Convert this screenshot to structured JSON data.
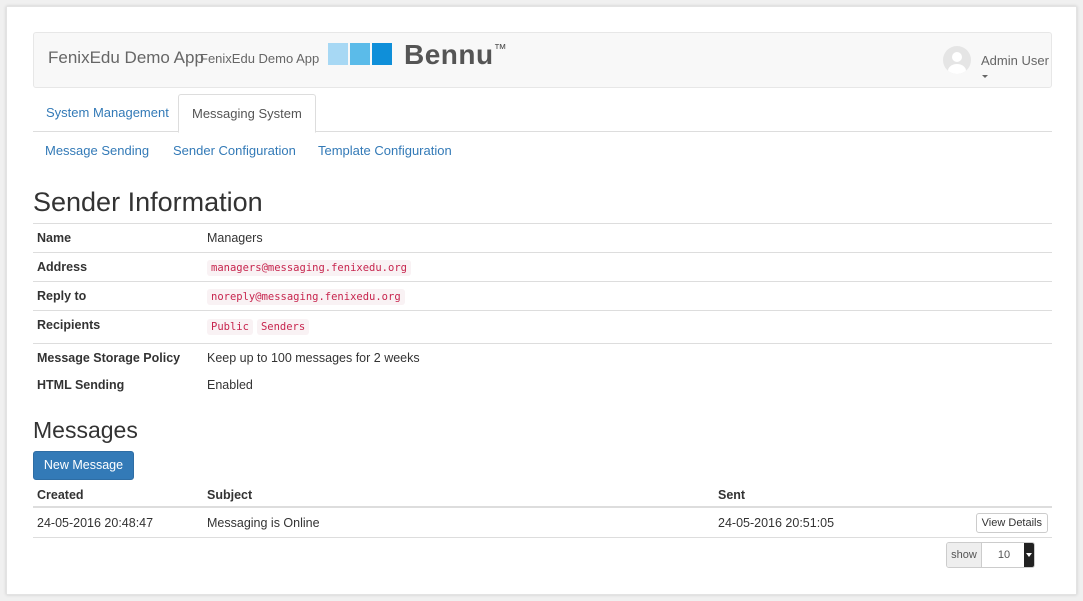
{
  "header": {
    "brand_main": "FenixEdu Demo App",
    "brand_sub": "FenixEdu Demo App",
    "logo_text": "Bennu",
    "logo_mark": "™",
    "logo_colors": [
      "#a7d8f4",
      "#5bbbe9",
      "#0f8fd9"
    ],
    "user_name": "Admin User"
  },
  "tabs": [
    {
      "label": "System Management",
      "active": false
    },
    {
      "label": "Messaging System",
      "active": true
    }
  ],
  "subnav": [
    {
      "label": "Message Sending"
    },
    {
      "label": "Sender Configuration"
    },
    {
      "label": "Template Configuration"
    }
  ],
  "sender": {
    "title": "Sender Information",
    "name_label": "Name",
    "name_value": "Managers",
    "address_label": "Address",
    "address_value": "managers@messaging.fenixedu.org",
    "reply_label": "Reply to",
    "reply_value": "noreply@messaging.fenixedu.org",
    "recipients_label": "Recipients",
    "recipients": [
      "Public",
      "Senders"
    ],
    "storage_label": "Message Storage Policy",
    "storage_value": "Keep up to 100 messages for 2 weeks",
    "html_label": "HTML Sending",
    "html_value": "Enabled"
  },
  "messages": {
    "title": "Messages",
    "new_button": "New Message",
    "columns": [
      "Created",
      "Subject",
      "Sent"
    ],
    "rows": [
      {
        "created": "24-05-2016 20:48:47",
        "subject": "Messaging is Online",
        "sent": "24-05-2016 20:51:05",
        "action": "View Details"
      }
    ],
    "pager_label": "show",
    "pager_value": "10"
  },
  "colors": {
    "link": "#337ab7",
    "primary": "#337ab7",
    "code_text": "#c7254e",
    "code_bg": "#f9f2f4"
  }
}
